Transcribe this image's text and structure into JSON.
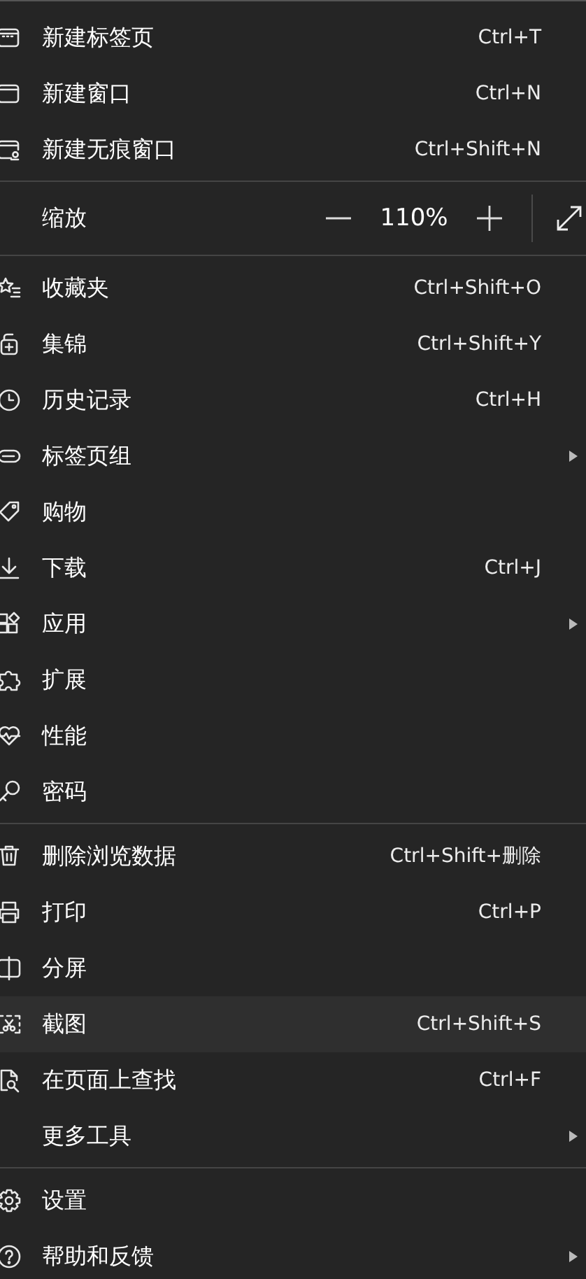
{
  "menu": {
    "sections": [
      [
        {
          "kind": "item",
          "label": "新建标签页",
          "shortcut": "Ctrl+T",
          "submenu": false,
          "highlighted": false
        },
        {
          "kind": "item",
          "label": "新建窗口",
          "shortcut": "Ctrl+N",
          "submenu": false,
          "highlighted": false
        },
        {
          "kind": "item",
          "label": "新建无痕窗口",
          "shortcut": "Ctrl+Shift+N",
          "submenu": false,
          "highlighted": false
        }
      ],
      [
        {
          "kind": "zoom",
          "label": "缩放",
          "value": "110%"
        }
      ],
      [
        {
          "kind": "item",
          "label": "收藏夹",
          "shortcut": "Ctrl+Shift+O",
          "submenu": false,
          "highlighted": false
        },
        {
          "kind": "item",
          "label": "集锦",
          "shortcut": "Ctrl+Shift+Y",
          "submenu": false,
          "highlighted": false
        },
        {
          "kind": "item",
          "label": "历史记录",
          "shortcut": "Ctrl+H",
          "submenu": false,
          "highlighted": false
        },
        {
          "kind": "item",
          "label": "标签页组",
          "submenu": true,
          "highlighted": false
        },
        {
          "kind": "item",
          "label": "购物",
          "submenu": false,
          "highlighted": false
        },
        {
          "kind": "item",
          "label": "下载",
          "shortcut": "Ctrl+J",
          "submenu": false,
          "highlighted": false
        },
        {
          "kind": "item",
          "label": "应用",
          "submenu": true,
          "highlighted": false
        },
        {
          "kind": "item",
          "label": "扩展",
          "submenu": false,
          "highlighted": false
        },
        {
          "kind": "item",
          "label": "性能",
          "submenu": false,
          "highlighted": false
        },
        {
          "kind": "item",
          "label": "密码",
          "submenu": false,
          "highlighted": false
        }
      ],
      [
        {
          "kind": "item",
          "label": "删除浏览数据",
          "shortcut": "Ctrl+Shift+删除",
          "submenu": false,
          "highlighted": false
        },
        {
          "kind": "item",
          "label": "打印",
          "shortcut": "Ctrl+P",
          "submenu": false,
          "highlighted": false
        },
        {
          "kind": "item",
          "label": "分屏",
          "submenu": false,
          "highlighted": false
        },
        {
          "kind": "item",
          "label": "截图",
          "shortcut": "Ctrl+Shift+S",
          "submenu": false,
          "highlighted": true
        },
        {
          "kind": "item",
          "label": "在页面上查找",
          "shortcut": "Ctrl+F",
          "submenu": false,
          "highlighted": false
        },
        {
          "kind": "item",
          "label": "更多工具",
          "submenu": true,
          "highlighted": false
        }
      ],
      [
        {
          "kind": "item",
          "label": "设置",
          "submenu": false,
          "highlighted": false
        },
        {
          "kind": "item",
          "label": "帮助和反馈",
          "submenu": true,
          "highlighted": false
        }
      ]
    ]
  }
}
